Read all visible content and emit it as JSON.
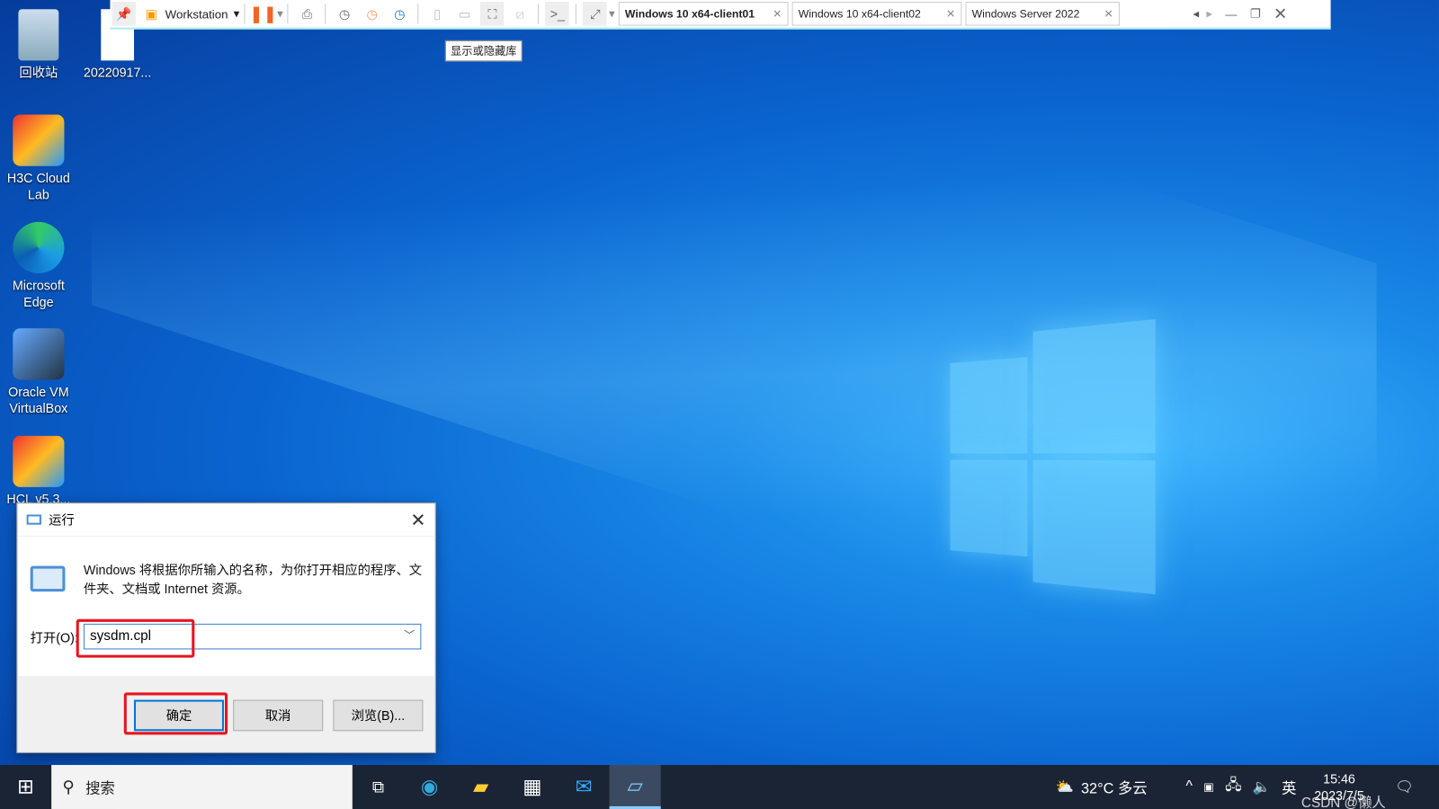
{
  "vm_toolbar": {
    "menu": "Workstation",
    "tooltip": "显示或隐藏库",
    "tabs": [
      {
        "label": "Windows 10 x64-client01",
        "active": true
      },
      {
        "label": "Windows 10 x64-client02",
        "active": false
      },
      {
        "label": "Windows Server 2022",
        "active": false
      }
    ],
    "pause_color": "#f26522"
  },
  "desktop": {
    "icons": [
      {
        "label": "回收站",
        "icon": "recycle-bin-icon"
      },
      {
        "label": "20220917...",
        "icon": "file-icon"
      },
      {
        "label": "H3C Cloud Lab",
        "icon": "h3c-cloud-lab-icon"
      },
      {
        "label": "Microsoft Edge",
        "icon": "edge-icon"
      },
      {
        "label": "Oracle VM VirtualBox",
        "icon": "virtualbox-icon"
      },
      {
        "label": "HCL v5.3...",
        "icon": "hcl-icon"
      }
    ]
  },
  "run_dialog": {
    "title": "运行",
    "description": "Windows 将根据你所输入的名称，为你打开相应的程序、文件夹、文档或 Internet 资源。",
    "open_label": "打开(O):",
    "input_value": "sysdm.cpl",
    "ok": "确定",
    "cancel": "取消",
    "browse": "浏览(B)...",
    "highlight_color": "#e8141e"
  },
  "taskbar": {
    "search_placeholder": "搜索",
    "weather": "32°C  多云",
    "ime": "英",
    "time": "15:46",
    "date": "2023/7/5",
    "watermark": "CSDN @懒人"
  }
}
